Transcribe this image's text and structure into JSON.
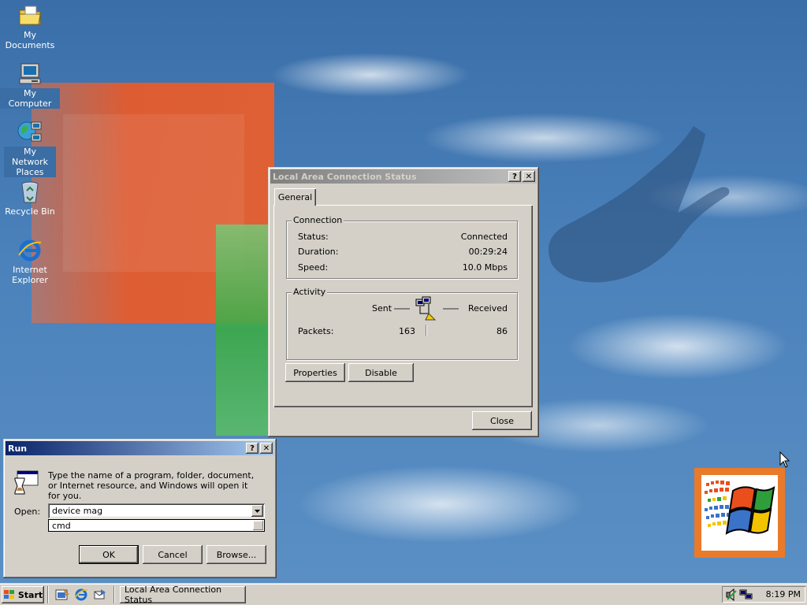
{
  "desktop": {
    "icons": [
      {
        "label": "My Documents",
        "icon": "folder-icon"
      },
      {
        "label": "My Computer",
        "icon": "computer-icon"
      },
      {
        "label": "My Network Places",
        "icon": "network-icon"
      },
      {
        "label": "Recycle Bin",
        "icon": "recycle-bin-icon"
      },
      {
        "label": "Internet Explorer",
        "icon": "internet-explorer-icon"
      }
    ]
  },
  "status_dialog": {
    "title": "Local Area Connection Status",
    "help_button": "?",
    "close_x": "✕",
    "tab_general": "General",
    "connection_group": "Connection",
    "status_label": "Status:",
    "status_value": "Connected",
    "duration_label": "Duration:",
    "duration_value": "00:29:24",
    "speed_label": "Speed:",
    "speed_value": "10.0 Mbps",
    "activity_group": "Activity",
    "sent_label": "Sent",
    "received_label": "Received",
    "packets_label": "Packets:",
    "packets_sent": "163",
    "packets_received": "86",
    "properties_button": "Properties",
    "disable_button": "Disable",
    "close_button": "Close"
  },
  "run_dialog": {
    "title": "Run",
    "help_button": "?",
    "close_x": "✕",
    "description": "Type the name of a program, folder, document, or Internet resource, and Windows will open it for you.",
    "open_label": "Open:",
    "open_value": "device mag",
    "dropdown_item": "cmd",
    "ok_button": "OK",
    "cancel_button": "Cancel",
    "browse_button": "Browse..."
  },
  "taskbar": {
    "start_label": "Start",
    "quick_launch": [
      "show-desktop-icon",
      "internet-explorer-icon",
      "outlook-express-icon"
    ],
    "task_item": "Local Area Connection Status",
    "clock": "8:19 PM",
    "tray_icons": [
      "volume-icon",
      "network-tray-icon"
    ]
  },
  "colors": {
    "desktop_blue": "#3a6ea8",
    "active_title_start": "#0a246a",
    "active_title_end": "#a6caf0",
    "inactive_title": "#808080",
    "face": "#d4d0c8",
    "orange": "#e97a2a"
  }
}
